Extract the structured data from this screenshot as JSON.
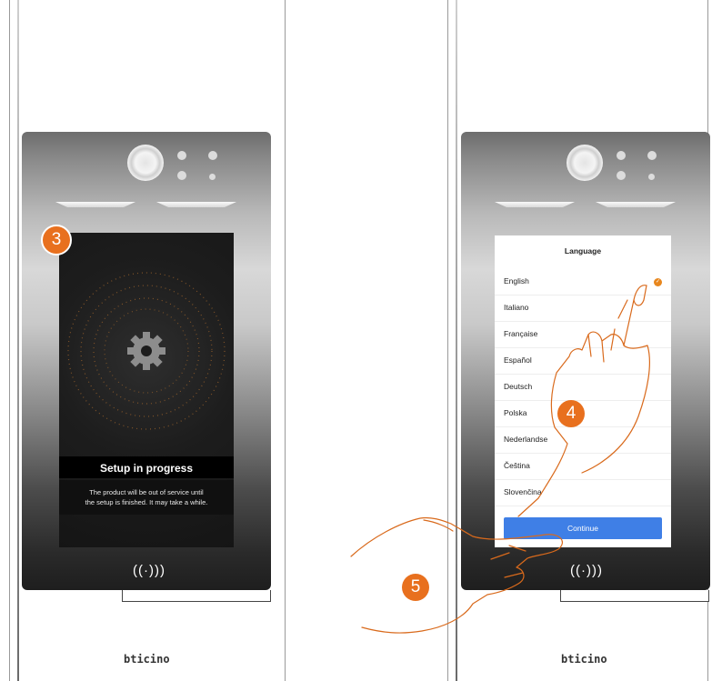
{
  "brand": "bticino",
  "nfc_symbol": "((·)))",
  "steps": [
    "3",
    "4",
    "5"
  ],
  "left_device": {
    "title": "Setup in progress",
    "description_line1": "The product will be out of service until",
    "description_line2": "the setup is finished. It may take a while."
  },
  "right_device": {
    "title": "Language",
    "languages": [
      {
        "label": "English",
        "selected": true
      },
      {
        "label": "Italiano",
        "selected": false
      },
      {
        "label": "Française",
        "selected": false
      },
      {
        "label": "Español",
        "selected": false
      },
      {
        "label": "Deutsch",
        "selected": false
      },
      {
        "label": "Polska",
        "selected": false
      },
      {
        "label": "Nederlandse",
        "selected": false
      },
      {
        "label": "Čeština",
        "selected": false
      },
      {
        "label": "Slovenčina",
        "selected": false
      }
    ],
    "continue_label": "Continue"
  },
  "colors": {
    "accent": "#e8701e",
    "button": "#3f7fe6",
    "hand_stroke": "#d96a1c"
  }
}
